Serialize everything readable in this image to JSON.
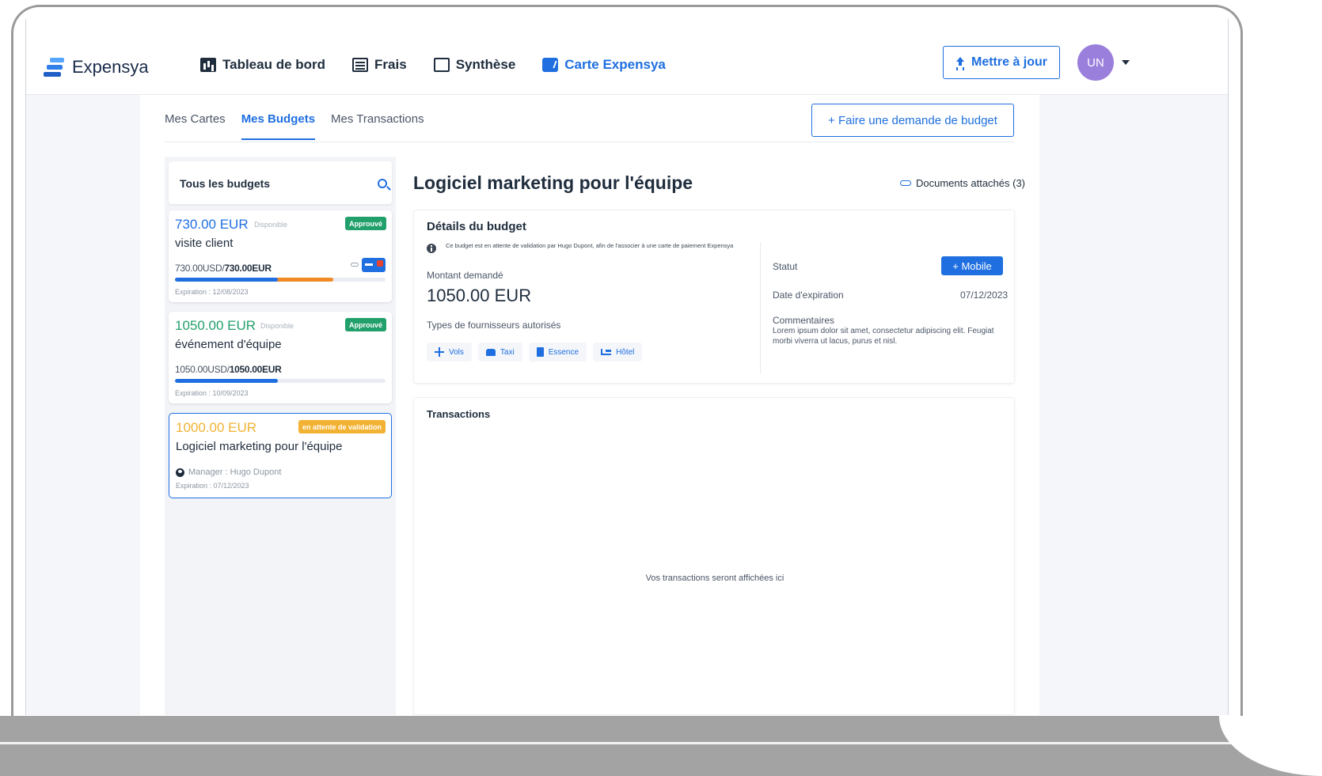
{
  "app": {
    "name": "Expensya"
  },
  "nav": {
    "items": [
      {
        "label": "Tableau de bord",
        "icon": "dashboard-icon",
        "active": false
      },
      {
        "label": "Frais",
        "icon": "list-icon",
        "active": false
      },
      {
        "label": "Synthèse",
        "icon": "window-icon",
        "active": false
      },
      {
        "label": "Carte Expensya",
        "icon": "card-icon",
        "active": true
      }
    ],
    "update_label": "Mettre à jour",
    "avatar_initials": "UN"
  },
  "tabs": [
    {
      "label": "Mes Cartes",
      "active": false
    },
    {
      "label": "Mes Budgets",
      "active": true
    },
    {
      "label": "Mes Transactions",
      "active": false
    }
  ],
  "request_budget_label": "+ Faire une demande de budget",
  "budget_list": {
    "title": "Tous les budgets",
    "items": [
      {
        "amount": "730.00 EUR",
        "available_label": "Disponible",
        "status": "Approuvé",
        "name": "visite client",
        "spent": "730.00USD/",
        "total": "730.00EUR",
        "progress_blue": 0.49,
        "progress_orange": 0.75,
        "expiration": "Expiration : 12/08/2023"
      },
      {
        "amount": "1050.00 EUR",
        "available_label": "Disponible",
        "status": "Approuvé",
        "name": "événement d'équipe",
        "spent": "1050.00USD/",
        "total": "1050.00EUR",
        "progress_blue": 0.49,
        "expiration": "Expiration : 10/09/2023"
      },
      {
        "amount": "1000.00 EUR",
        "status": "en attente de validation",
        "name": "Logiciel marketing pour l'équipe",
        "manager": "Manager : Hugo Dupont",
        "expiration": "Expiration : 07/12/2023"
      }
    ]
  },
  "detail": {
    "title": "Logiciel marketing pour l'équipe",
    "documents_label": "Documents attachés (3)",
    "section_title": "Détails du budget",
    "info_text": "Ce budget est en attente de validation par Hugo Dupont, afin de l'associer à une carte de paiement Expensya",
    "amount_label": "Montant demandé",
    "amount": "1050.00 EUR",
    "suppliers_label": "Types de fournisseurs autorisés",
    "suppliers": [
      "Vols",
      "Taxi",
      "Essence",
      "Hôtel"
    ],
    "status_label": "Statut",
    "mobile_label": "+ Mobile",
    "expiration_label": "Date d'expiration",
    "expiration_date": "07/12/2023",
    "comments_label": "Commentaires",
    "comments": "Lorem ipsum dolor sit amet, consectetur adipiscing elit. Feugiat morbi viverra ut lacus, purus et nisl."
  },
  "transactions": {
    "title": "Transactions",
    "empty_text": "Vos transactions seront affichées ici"
  },
  "colors": {
    "primary": "#1f6fe0",
    "approved": "#22a06b",
    "pending": "#f2b233",
    "avatar": "#9b7fdc"
  }
}
